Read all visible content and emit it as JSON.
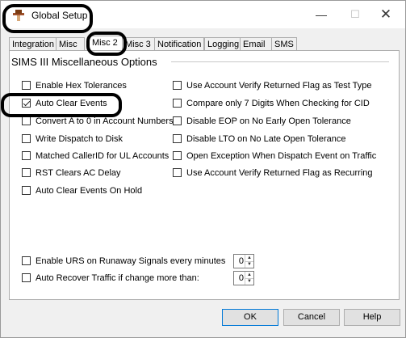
{
  "window": {
    "title": "Global Setup"
  },
  "titlebar_controls": {
    "minimize": "—",
    "maximize": "☐",
    "close": "✕"
  },
  "tabs": [
    {
      "label": "Integration",
      "active": false
    },
    {
      "label": "Misc",
      "active": false
    },
    {
      "label": "Misc 2",
      "active": true
    },
    {
      "label": "Misc 3",
      "active": false
    },
    {
      "label": "Notification",
      "active": false
    },
    {
      "label": "Logging",
      "active": false
    },
    {
      "label": "Email",
      "active": false
    },
    {
      "label": "SMS",
      "active": false
    }
  ],
  "group": {
    "title": "SIMS III Miscellaneous Options"
  },
  "left_options": [
    {
      "label": "Enable Hex Tolerances",
      "checked": false
    },
    {
      "label": "Auto Clear Events",
      "checked": true
    },
    {
      "label": "Convert A to 0 in Account Numbers",
      "checked": false
    },
    {
      "label": "Write Dispatch to Disk",
      "checked": false
    },
    {
      "label": "Matched CallerID for UL Accounts",
      "checked": false
    },
    {
      "label": "RST Clears AC Delay",
      "checked": false
    },
    {
      "label": "Auto Clear Events On Hold",
      "checked": false
    }
  ],
  "right_options": [
    {
      "label": "Use Account Verify Returned Flag as Test Type",
      "checked": false
    },
    {
      "label": "Compare only 7 Digits When Checking for CID",
      "checked": false
    },
    {
      "label": "Disable EOP on No Early Open Tolerance",
      "checked": false
    },
    {
      "label": "Disable LTO on No Late Open Tolerance",
      "checked": false
    },
    {
      "label": "Open Exception When Dispatch Event on Traffic",
      "checked": false
    },
    {
      "label": "Use Account Verify Returned Flag as Recurring",
      "checked": false
    }
  ],
  "bottom_options": [
    {
      "label": "Enable URS on Runaway Signals every minutes",
      "checked": false,
      "value": "0"
    },
    {
      "label": "Auto Recover Traffic if change more than:",
      "checked": false,
      "value": "0"
    }
  ],
  "buttons": {
    "ok": "OK",
    "cancel": "Cancel",
    "help": "Help"
  },
  "colors": {
    "window_bg": "#f0f0f0",
    "panel_bg": "#ffffff",
    "default_button_border": "#0078d7",
    "annotation": "#000000"
  },
  "icons": {
    "app": "hat-icon",
    "spin_up": "arrow-up-icon",
    "spin_down": "arrow-down-icon"
  }
}
